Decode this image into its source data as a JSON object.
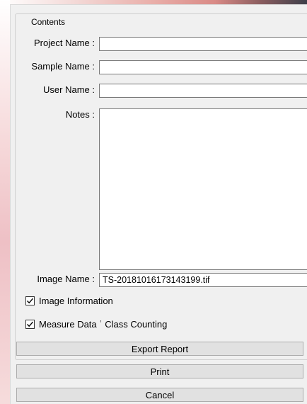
{
  "contents": {
    "group_title": "Contents",
    "project_name_label": "Project Name :",
    "project_name_value": "",
    "sample_name_label": "Sample Name :",
    "sample_name_value": "",
    "user_name_label": "User Name :",
    "user_name_value": "",
    "notes_label": "Notes :",
    "notes_value": "",
    "image_name_label": "Image Name :",
    "image_name_value": "TS-20181016173143199.tif"
  },
  "options": {
    "image_information_label": "Image Information",
    "image_information_checked": true,
    "measure_data_label": "Measure Data ʿ Class Counting",
    "measure_data_checked": true
  },
  "buttons": {
    "export_label": "Export Report",
    "print_label": "Print",
    "cancel_label": "Cancel"
  }
}
